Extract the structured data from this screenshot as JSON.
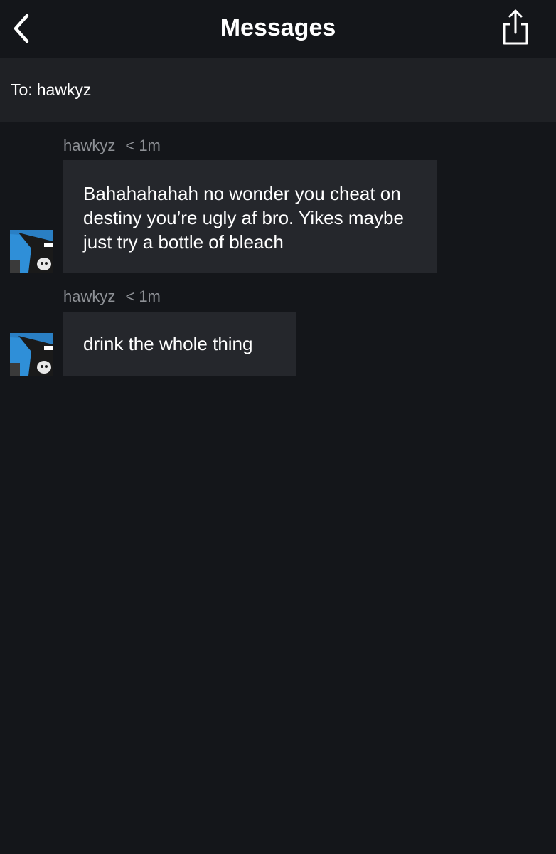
{
  "header": {
    "title": "Messages",
    "back_icon": "chevron-left-icon",
    "share_icon": "share-icon"
  },
  "recipient": {
    "prefix": "To:",
    "name": "hawkyz"
  },
  "messages": [
    {
      "sender": "hawkyz",
      "time": "< 1m",
      "text": "Bahahahahah no wonder you cheat on destiny you’re ugly af bro.  Yikes maybe just try a bottle of bleach"
    },
    {
      "sender": "hawkyz",
      "time": "< 1m",
      "text": "drink the whole thing"
    }
  ],
  "colors": {
    "background": "#14161a",
    "bar": "#1f2125",
    "bubble": "#25272c",
    "meta_text": "#8e9196",
    "avatar_blue": "#2f8fd8"
  }
}
